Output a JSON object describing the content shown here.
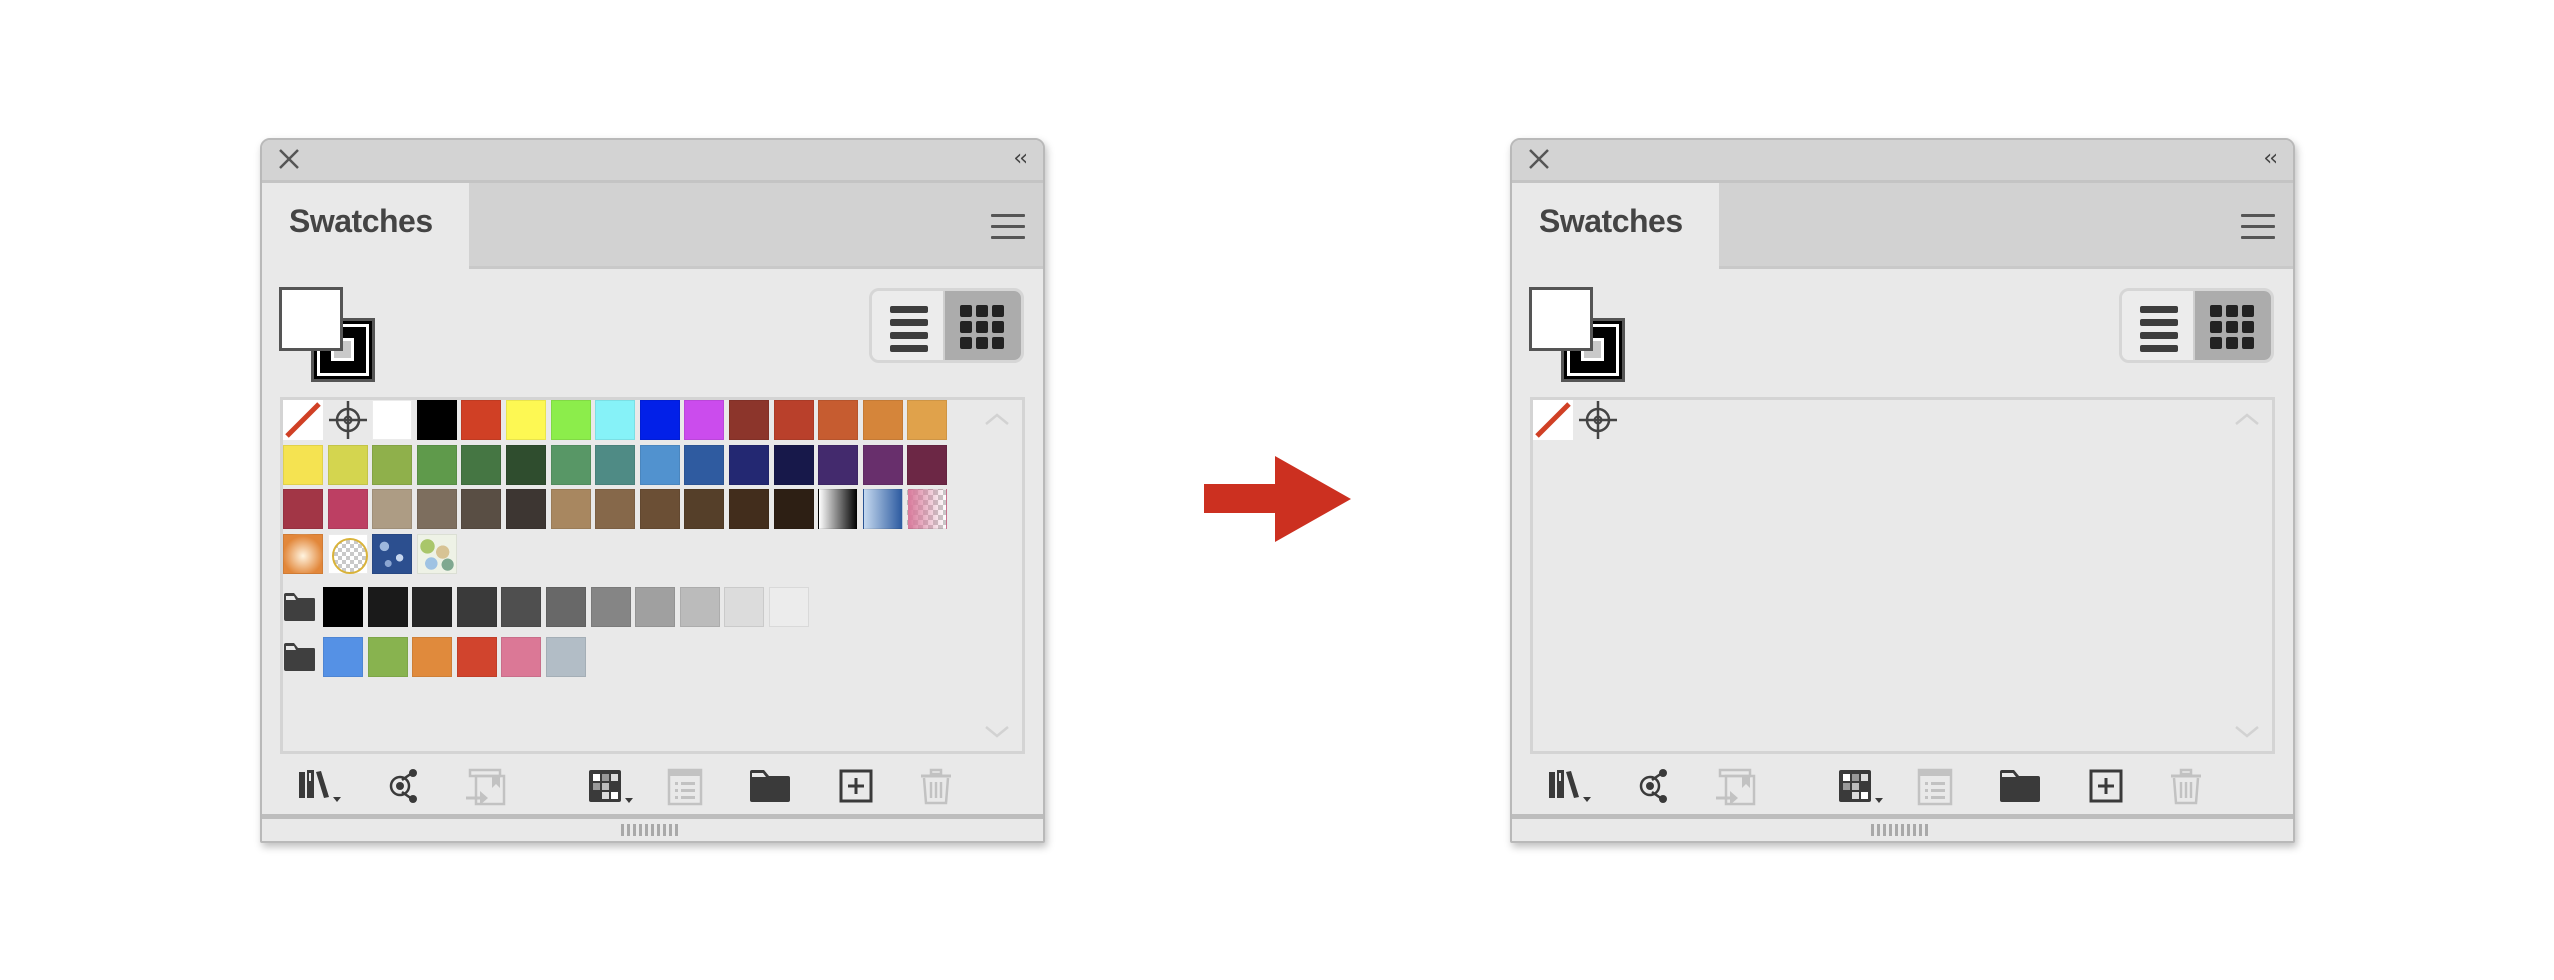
{
  "panels": [
    {
      "id": "before",
      "title": "Swatches",
      "close_icon": "close-icon",
      "collapse_label": "‹‹",
      "menu_icon": "hamburger-menu-icon",
      "fill_color": "#ffffff",
      "stroke_color": "#000000",
      "view_mode": "grid",
      "swatch_rows": [
        [
          {
            "type": "none",
            "name": "[None]"
          },
          {
            "type": "registration",
            "name": "[Registration]"
          },
          {
            "type": "color",
            "color": "#ffffff"
          },
          {
            "type": "color",
            "color": "#000000"
          },
          {
            "type": "color",
            "color": "#d04025"
          },
          {
            "type": "color",
            "color": "#fdf853"
          },
          {
            "type": "color",
            "color": "#8ced4b"
          },
          {
            "type": "color",
            "color": "#86f2f8"
          },
          {
            "type": "color",
            "color": "#0220e8"
          },
          {
            "type": "color",
            "color": "#cb4ced"
          },
          {
            "type": "color",
            "color": "#8c352b"
          },
          {
            "type": "color",
            "color": "#b9402b"
          },
          {
            "type": "color",
            "color": "#c65c30"
          },
          {
            "type": "color",
            "color": "#d5853a"
          },
          {
            "type": "color",
            "color": "#e0a24b"
          }
        ],
        [
          {
            "type": "color",
            "color": "#f5e351"
          },
          {
            "type": "color",
            "color": "#d4d54f"
          },
          {
            "type": "color",
            "color": "#8fb04b"
          },
          {
            "type": "color",
            "color": "#5f9a4b"
          },
          {
            "type": "color",
            "color": "#457643"
          },
          {
            "type": "color",
            "color": "#2f4d2e"
          },
          {
            "type": "color",
            "color": "#589766"
          },
          {
            "type": "color",
            "color": "#4f8b85"
          },
          {
            "type": "color",
            "color": "#5192cf"
          },
          {
            "type": "color",
            "color": "#2f5ba0"
          },
          {
            "type": "color",
            "color": "#232872"
          },
          {
            "type": "color",
            "color": "#17184a"
          },
          {
            "type": "color",
            "color": "#432a6d"
          },
          {
            "type": "color",
            "color": "#682f6c"
          },
          {
            "type": "color",
            "color": "#6c2745"
          }
        ],
        [
          {
            "type": "color",
            "color": "#a23646"
          },
          {
            "type": "color",
            "color": "#bd3f63"
          },
          {
            "type": "color",
            "color": "#ad9c84"
          },
          {
            "type": "color",
            "color": "#7d6e5e"
          },
          {
            "type": "color",
            "color": "#594e44"
          },
          {
            "type": "color",
            "color": "#3d3632"
          },
          {
            "type": "color",
            "color": "#a88760"
          },
          {
            "type": "color",
            "color": "#86684a"
          },
          {
            "type": "color",
            "color": "#6b4f35"
          },
          {
            "type": "color",
            "color": "#553f29"
          },
          {
            "type": "color",
            "color": "#422d1c"
          },
          {
            "type": "color",
            "color": "#2d1f14"
          },
          {
            "type": "gradient",
            "from": "#ffffff",
            "to": "#000000"
          },
          {
            "type": "gradient",
            "from": "#c5d9ef",
            "to": "#2c5aa0"
          },
          {
            "type": "pattern-checker",
            "color": "#d87a9b"
          }
        ],
        [
          {
            "type": "radial",
            "from": "#fff4e0",
            "to": "#e2873a"
          },
          {
            "type": "pattern-circle",
            "color": "#d9b33a"
          },
          {
            "type": "pattern-blue",
            "color": "#2c4f8f"
          },
          {
            "type": "pattern-camo",
            "color": "#a9c66a"
          }
        ]
      ],
      "groups": [
        {
          "icon": "folder-icon",
          "colors": [
            "#000000",
            "#1a1a1a",
            "#262626",
            "#3a3a3a",
            "#4f4f4f",
            "#686868",
            "#858585",
            "#a0a0a0",
            "#bbbbbb",
            "#dcdcdc",
            "#ececec"
          ]
        },
        {
          "icon": "folder-icon",
          "colors": [
            "#5591e5",
            "#88b34f",
            "#e08a3c",
            "#d1442d",
            "#db7896",
            "#b2bdc6"
          ]
        }
      ]
    },
    {
      "id": "after",
      "title": "Swatches",
      "close_icon": "close-icon",
      "collapse_label": "‹‹",
      "menu_icon": "hamburger-menu-icon",
      "fill_color": "#ffffff",
      "stroke_color": "#000000",
      "view_mode": "grid",
      "swatch_rows": [
        [
          {
            "type": "none",
            "name": "[None]"
          },
          {
            "type": "registration",
            "name": "[Registration]"
          }
        ]
      ],
      "groups": []
    }
  ],
  "toolbar": [
    {
      "name": "swatch-libraries-menu-button",
      "icon": "library-icon",
      "enabled": true,
      "dropdown": true
    },
    {
      "name": "add-used-colors-button",
      "icon": "nodes-icon",
      "enabled": true,
      "dropdown": false
    },
    {
      "name": "place-swatches-button",
      "icon": "import-icon",
      "enabled": false,
      "dropdown": false
    },
    {
      "name": "show-swatch-kinds-button",
      "icon": "swatch-kinds-icon",
      "enabled": true,
      "dropdown": true
    },
    {
      "name": "swatch-options-button",
      "icon": "swatch-options-icon",
      "enabled": false,
      "dropdown": false
    },
    {
      "name": "new-color-group-button",
      "icon": "folder-icon",
      "enabled": true,
      "dropdown": false
    },
    {
      "name": "new-swatch-button",
      "icon": "new-swatch-icon",
      "enabled": true,
      "dropdown": false
    },
    {
      "name": "delete-swatch-button",
      "icon": "trash-icon",
      "enabled": false,
      "dropdown": false
    }
  ],
  "transition_arrow": {
    "color": "#cc3020",
    "icon": "right-arrow-icon"
  }
}
